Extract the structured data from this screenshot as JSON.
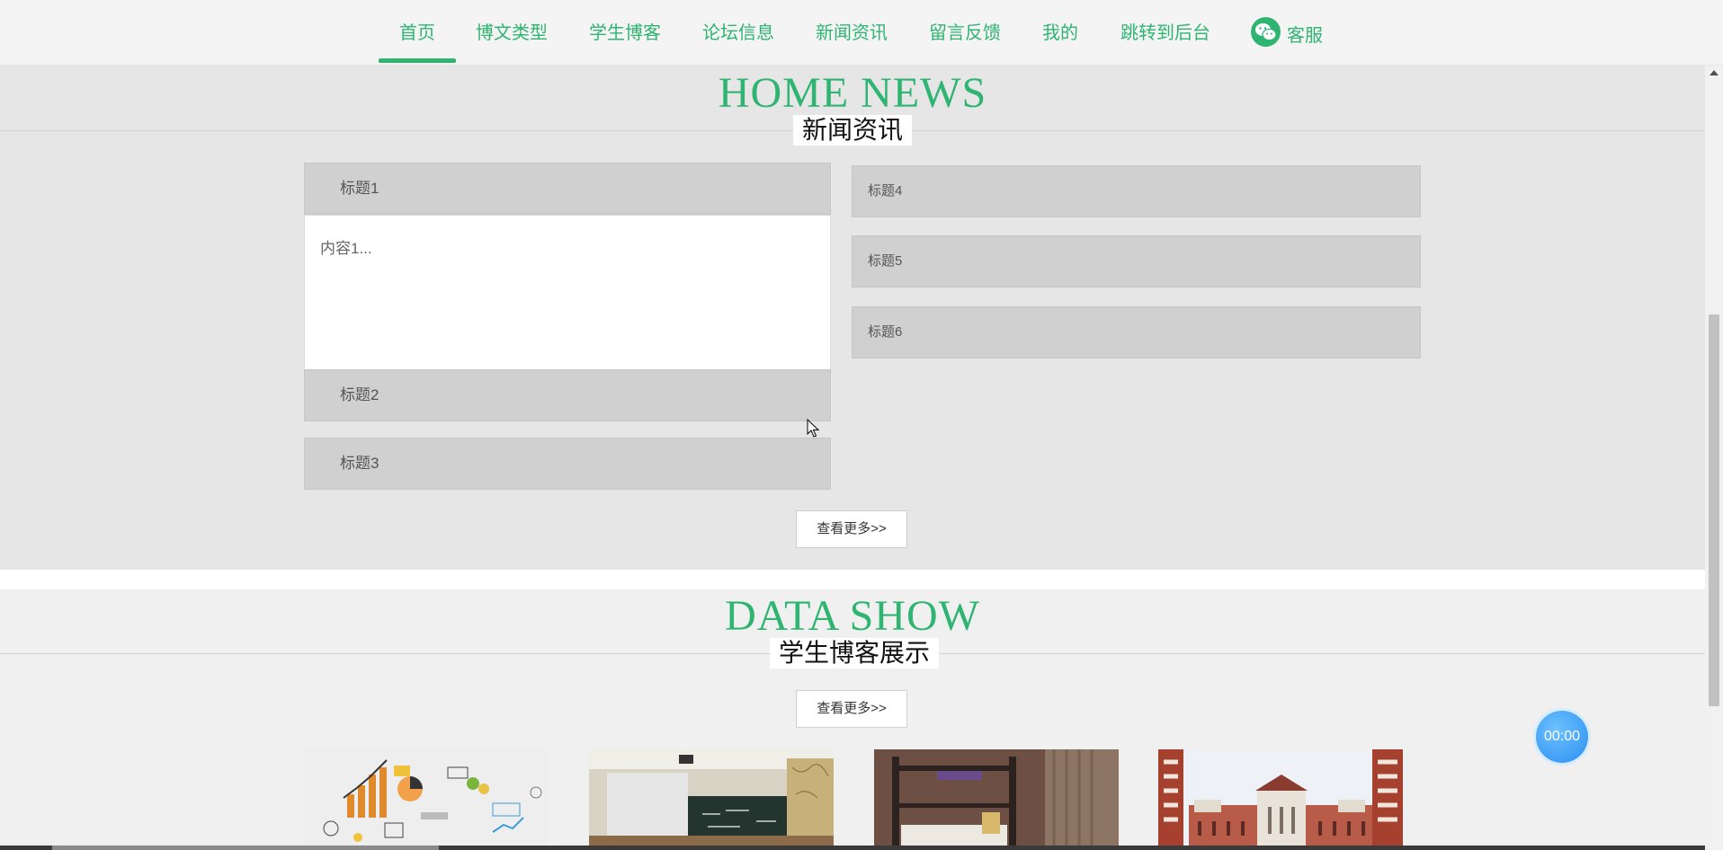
{
  "nav": {
    "items": [
      {
        "label": "首页",
        "active": true
      },
      {
        "label": "博文类型"
      },
      {
        "label": "学生博客"
      },
      {
        "label": "论坛信息"
      },
      {
        "label": "新闻资讯"
      },
      {
        "label": "留言反馈"
      },
      {
        "label": "我的"
      },
      {
        "label": "跳转到后台"
      }
    ],
    "service": {
      "label": "客服",
      "icon": "wechat-icon"
    },
    "accent_color": "#2fb472"
  },
  "news": {
    "title_en": "HOME NEWS",
    "title_cn": "新闻资讯",
    "left_items": [
      {
        "title": "标题1",
        "content": "内容1..."
      },
      {
        "title": "标题2"
      },
      {
        "title": "标题3"
      }
    ],
    "right_items": [
      {
        "title": "标题4"
      },
      {
        "title": "标题5"
      },
      {
        "title": "标题6"
      }
    ],
    "more_label": "查看更多>>"
  },
  "data_show": {
    "title_en": "DATA SHOW",
    "title_cn": "学生博客展示",
    "more_label": "查看更多>>",
    "thumbnails": [
      "infographic-sketch",
      "classroom-blackboard",
      "dorm-bunk-bed",
      "campus-building"
    ]
  },
  "timer": {
    "label": "00:00"
  }
}
